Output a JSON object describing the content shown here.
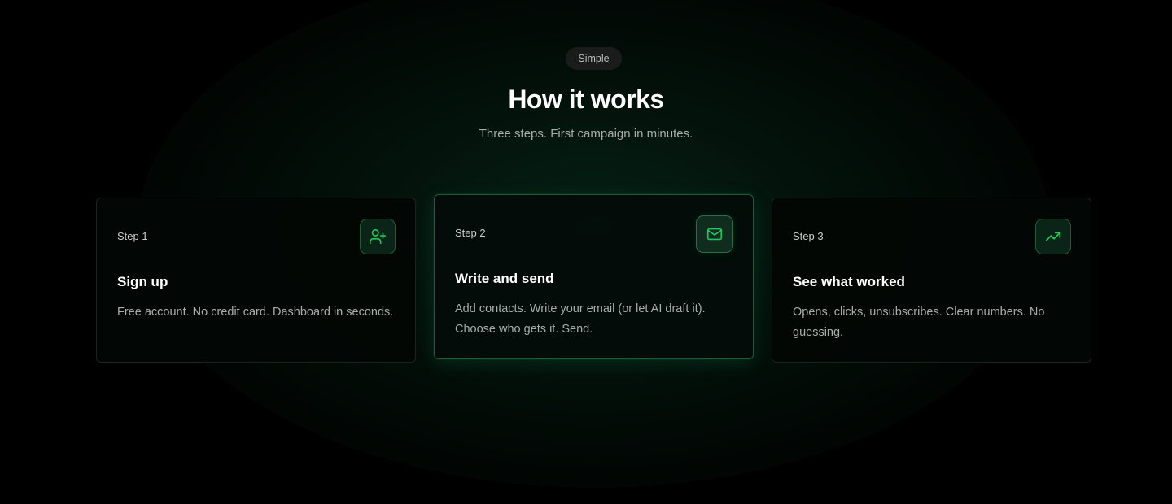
{
  "header": {
    "badge": "Simple",
    "title": "How it works",
    "subtitle": "Three steps. First campaign in minutes."
  },
  "colors": {
    "accent": "#22c55e",
    "background": "#000000",
    "card_border_active": "#1f5a3a"
  },
  "steps": [
    {
      "label": "Step 1",
      "title": "Sign up",
      "description": "Free account. No credit card. Dashboard in seconds.",
      "icon": "user-plus-icon",
      "highlighted": false
    },
    {
      "label": "Step 2",
      "title": "Write and send",
      "description": "Add contacts. Write your email (or let AI draft it). Choose who gets it. Send.",
      "icon": "mail-icon",
      "highlighted": true
    },
    {
      "label": "Step 3",
      "title": "See what worked",
      "description": "Opens, clicks, unsubscribes. Clear numbers. No guessing.",
      "icon": "trending-up-icon",
      "highlighted": false
    }
  ]
}
